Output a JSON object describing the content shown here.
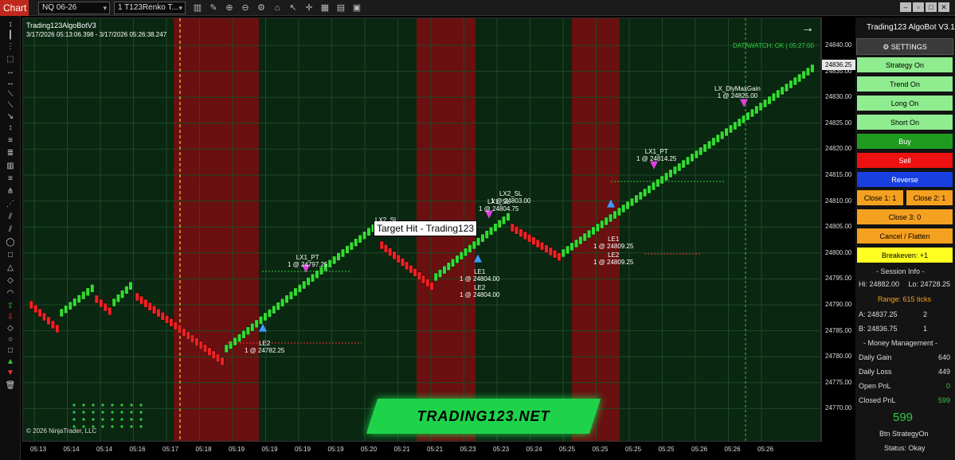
{
  "titlebar": {
    "chart_tab": "Chart",
    "instrument": "NQ 06-26",
    "bar_type": "1 T123Renko T..."
  },
  "chart": {
    "indicator_name": "Trading123AlgoBotV3",
    "date_range": "3/17/2026 05:13:06.398 - 3/17/2026 05:26:38.247",
    "datawatch": "DATAWATCH: OK | 05:27:00",
    "copyright": "© 2026 NinjaTrader, LLC",
    "target_hit": "Target Hit - Trading123",
    "logo": "TRADING123.NET",
    "colors": {
      "up": "#33dd33",
      "down": "#ee2222",
      "bg": "#0a2712",
      "band": "#6a1010"
    },
    "annotations": [
      {
        "name": "LX_DlyMaxGain",
        "line1": "LX_DlyMaxGain",
        "line2": "1 @ 24825.00"
      },
      {
        "name": "LX1_PT_a",
        "line1": "LX1_PT",
        "line2": "1 @ 24814.25"
      },
      {
        "name": "LX1_PT_b",
        "line1": "LX1_PT",
        "line2": "1 @ 24797.25"
      },
      {
        "name": "LX2_SL",
        "line1": "LX2_SL",
        "line2": "1 @ 24803.00"
      },
      {
        "name": "LX1_SL",
        "line1": "LX1_SL",
        "line2": "1 @ 24804.75"
      },
      {
        "name": "LX2_SL_b",
        "line1": "LX2_SL",
        "line2": ""
      },
      {
        "name": "LE1_a",
        "line1": "LE1",
        "line2": "1 @ 24809.25"
      },
      {
        "name": "LE2_a",
        "line1": "LE2",
        "line2": "1 @ 24809.25"
      },
      {
        "name": "LE1_b",
        "line1": "LE1",
        "line2": "1 @ 24804.00"
      },
      {
        "name": "LE2_b",
        "line1": "LE2",
        "line2": "1 @ 24804.00"
      },
      {
        "name": "LE2_c",
        "line1": "LE2",
        "line2": "1 @ 24782.25"
      }
    ],
    "price_ticks": [
      "24840.00",
      "24835.00",
      "24830.00",
      "24825.00",
      "24820.00",
      "24815.00",
      "24810.00",
      "24805.00",
      "24800.00",
      "24795.00",
      "24790.00",
      "24785.00",
      "24780.00",
      "24775.00",
      "24770.00"
    ],
    "current_price": "24836.25",
    "time_ticks": [
      "05:13",
      "05:14",
      "05:14",
      "05:16",
      "05:17",
      "05:18",
      "05:19",
      "05:19",
      "05:19",
      "05:19",
      "05:20",
      "05:21",
      "05:21",
      "05:23",
      "05:23",
      "05:24",
      "05:25",
      "05:25",
      "05:25",
      "05:25",
      "05:26",
      "05:26",
      "05:26"
    ]
  },
  "panel": {
    "title": "Trading123 AlgoBot V3.1",
    "settings_label": "SETTINGS",
    "buttons": {
      "strategy": "Strategy On",
      "trend": "Trend On",
      "long": "Long On",
      "short": "Short On",
      "buy": "Buy",
      "sell": "Sell",
      "reverse": "Reverse",
      "close1": "Close 1:  1",
      "close2": "Close 2:  1",
      "close3": "Close 3:  0",
      "cancel": "Cancel / Flatten",
      "breakeven": "Breakeven:  +1"
    },
    "session_info_label": "Session Info",
    "hi": "Hi: 24882.00",
    "lo": "Lo: 24728.25",
    "range": "Range: 615 ticks",
    "ask": "A: 24837.25",
    "ask_size": "2",
    "bid": "B: 24836.75",
    "bid_size": "1",
    "money_label": "Money Management",
    "rows": [
      {
        "label": "Daily Gain",
        "value": "640"
      },
      {
        "label": "Daily Loss",
        "value": "449"
      },
      {
        "label": "Open PnL",
        "value": "0"
      },
      {
        "label": "Closed PnL",
        "value": "599"
      }
    ],
    "big_pnl": "599",
    "btn_status": "Btn StrategyOn",
    "status": "Status: Okay"
  }
}
